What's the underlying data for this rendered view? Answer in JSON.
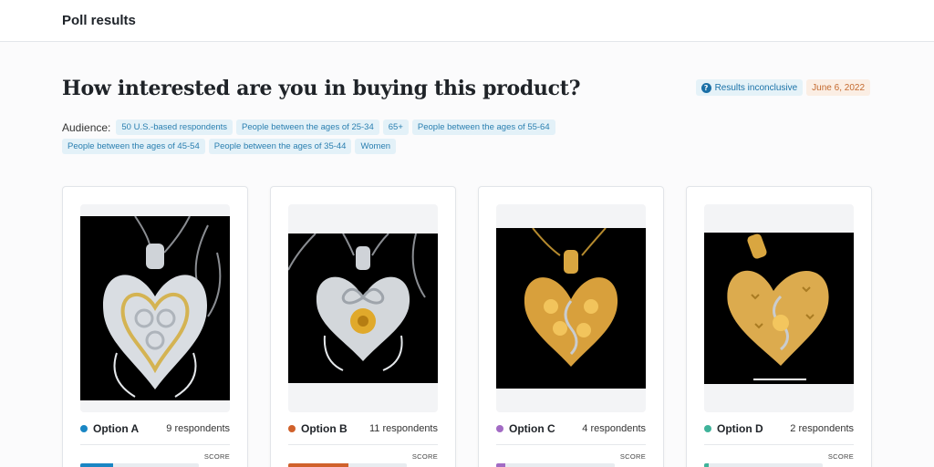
{
  "header": {
    "title": "Poll results"
  },
  "poll": {
    "question": "How interested are you in buying this product?",
    "status_label": "Results inconclusive",
    "date": "June 6, 2022",
    "audience_label": "Audience:",
    "audience_tags": [
      "50 U.S.-based respondents",
      "People between the ages of 25-34",
      "65+",
      "People between the ages of 55-64",
      "People between the ages of 45-54",
      "People between the ages of 35-44",
      "Women"
    ]
  },
  "options": [
    {
      "name": "Option A",
      "respondents": "9 respondents",
      "score_label": "SCORE",
      "score_fill": 0.28,
      "color": "#1a86c4",
      "metal": "silver"
    },
    {
      "name": "Option B",
      "respondents": "11 respondents",
      "score_label": "SCORE",
      "score_fill": 0.51,
      "color": "#d0612b",
      "metal": "silver-gold"
    },
    {
      "name": "Option C",
      "respondents": "4 respondents",
      "score_label": "SCORE",
      "score_fill": 0.08,
      "color": "#a26bc4",
      "metal": "gold"
    },
    {
      "name": "Option D",
      "respondents": "2 respondents",
      "score_label": "SCORE",
      "score_fill": 0.04,
      "color": "#3fb39a",
      "metal": "gold"
    }
  ],
  "icons": {
    "info": "question-circle-icon"
  }
}
